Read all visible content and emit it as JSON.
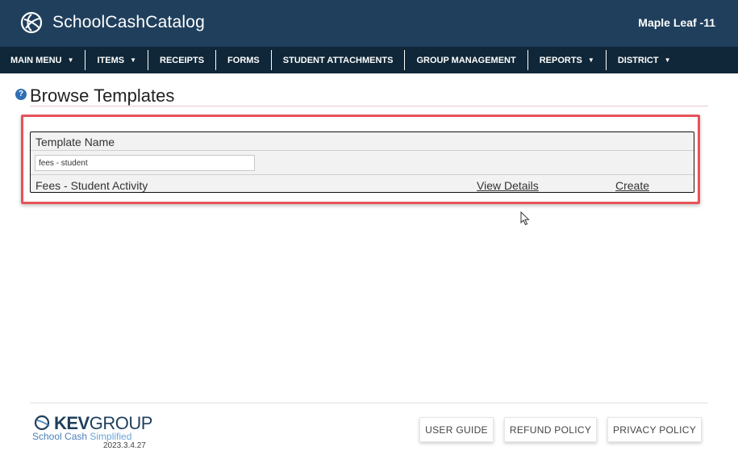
{
  "header": {
    "brand": "SchoolCashCatalog",
    "school": "Maple Leaf -11"
  },
  "nav": {
    "items": [
      {
        "label": "MAIN MENU",
        "caret": true
      },
      {
        "label": "ITEMS",
        "caret": true
      },
      {
        "label": "RECEIPTS",
        "caret": false
      },
      {
        "label": "FORMS",
        "caret": false
      },
      {
        "label": "STUDENT ATTACHMENTS",
        "caret": false
      },
      {
        "label": "GROUP MANAGEMENT",
        "caret": false
      },
      {
        "label": "REPORTS",
        "caret": true
      },
      {
        "label": "DISTRICT",
        "caret": true
      }
    ]
  },
  "page": {
    "help_icon": "?",
    "title": "Browse Templates"
  },
  "grid": {
    "column_header": "Template Name",
    "filter_value": "fees - student",
    "rows": [
      {
        "name": "Fees - Student Activity",
        "view_label": "View Details",
        "create_label": "Create"
      }
    ]
  },
  "footer": {
    "logo_kev": "KEV",
    "logo_group": "GROUP",
    "logo_sub_a": "School Cash ",
    "logo_sub_b": "Simplified",
    "version": "2023.3.4.27",
    "buttons": {
      "user_guide": "USER GUIDE",
      "refund_policy": "REFUND POLICY",
      "privacy_policy": "PRIVACY POLICY"
    }
  },
  "colors": {
    "header_bg": "#1f3f5c",
    "nav_bg": "#0f2738",
    "highlight": "#e8525a",
    "help_icon": "#2f6fb3"
  }
}
